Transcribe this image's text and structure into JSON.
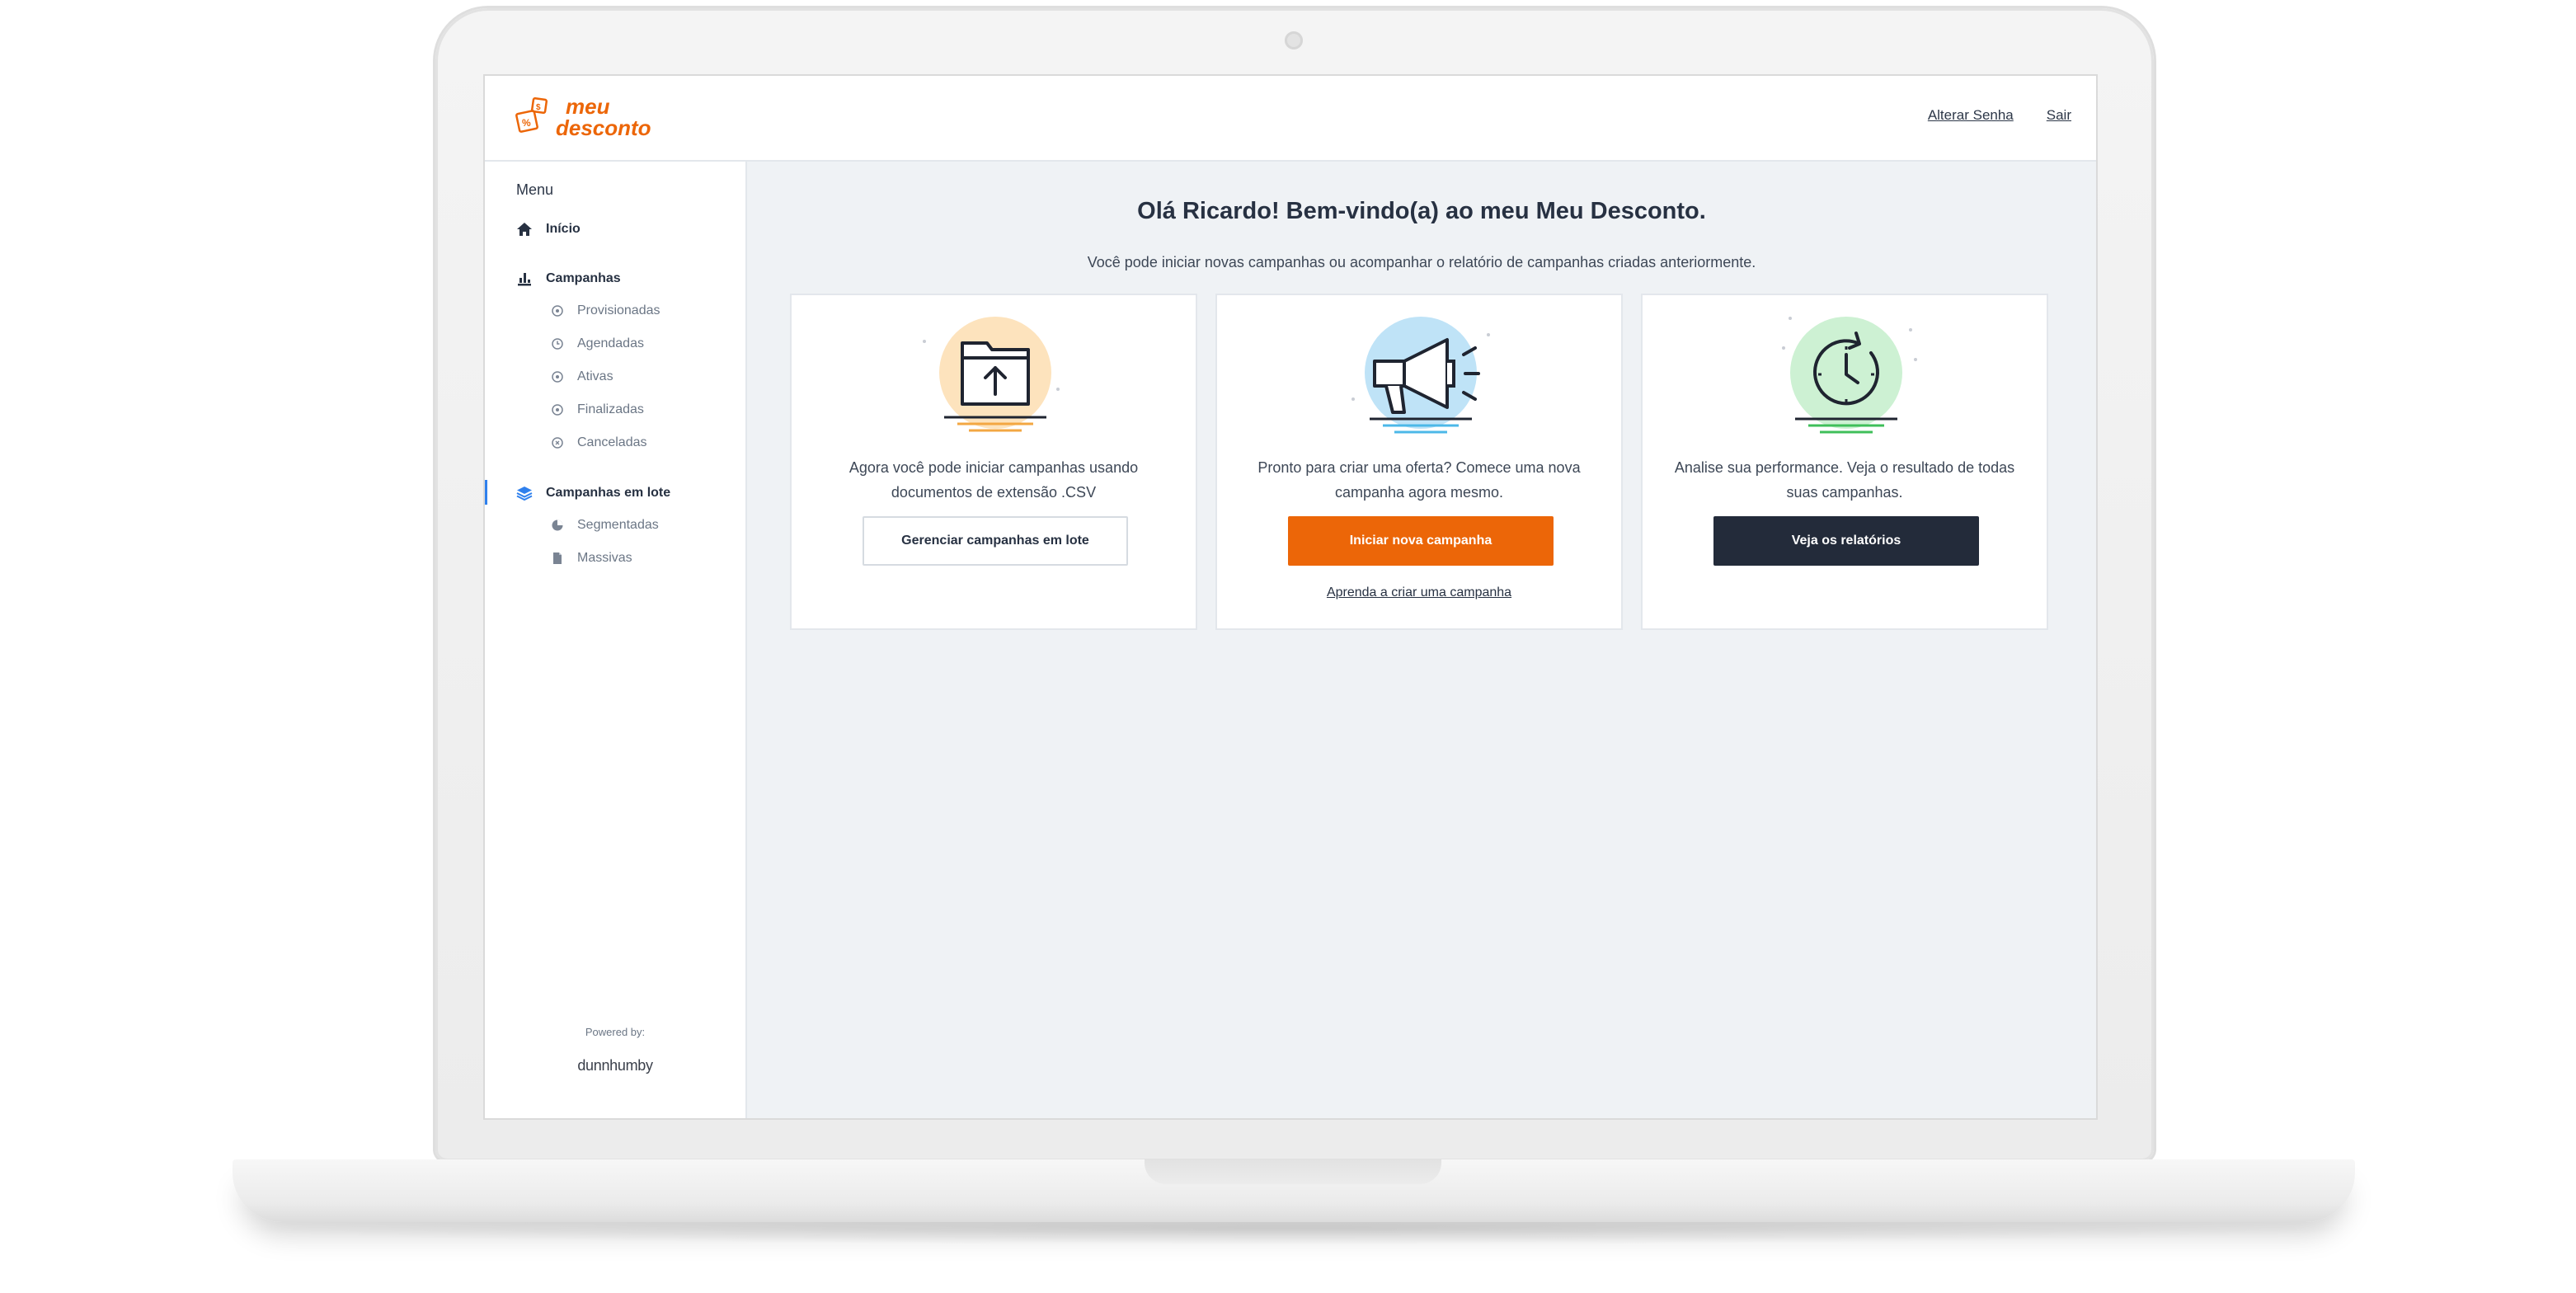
{
  "header": {
    "logo_line1": "meu",
    "logo_line2": "desconto",
    "change_password": "Alterar Senha",
    "logout": "Sair"
  },
  "sidebar": {
    "menu_title": "Menu",
    "home": "Início",
    "campaigns": "Campanhas",
    "campaign_items": [
      "Provisionadas",
      "Agendadas",
      "Ativas",
      "Finalizadas",
      "Canceladas"
    ],
    "batch": "Campanhas em lote",
    "batch_items": [
      "Segmentadas",
      "Massivas"
    ],
    "powered_by": "Powered by:",
    "brand": "dunnhumby"
  },
  "main": {
    "welcome": "Olá Ricardo! Bem-vindo(a) ao meu Meu Desconto.",
    "subtitle": "Você pode iniciar novas campanhas ou acompanhar o relatório de campanhas criadas anteriormente.",
    "cards": [
      {
        "icon": "folder-upload-icon",
        "text": "Agora você pode iniciar campanhas usando documentos de extensão .CSV",
        "button": "Gerenciar campanhas em lote"
      },
      {
        "icon": "megaphone-icon",
        "text": "Pronto para criar uma oferta? Comece uma nova campanha agora mesmo.",
        "button": "Iniciar nova campanha",
        "link": "Aprenda a criar uma campanha"
      },
      {
        "icon": "clock-history-icon",
        "text": "Analise sua performance. Veja o resultado de todas suas campanhas.",
        "button": "Veja os relatórios"
      }
    ]
  },
  "colors": {
    "brand_orange": "#ec6608",
    "dark_button": "#232b3a",
    "main_background": "#eff2f5",
    "active_indicator": "#2f80ed"
  }
}
